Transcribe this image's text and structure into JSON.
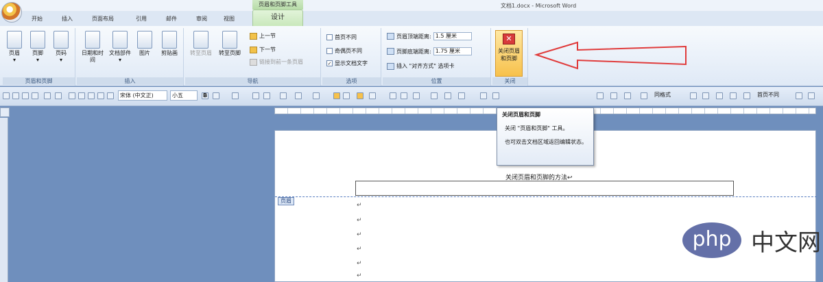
{
  "window": {
    "title": "文档1.docx - Microsoft Word",
    "context_group": "页眉和页脚工具"
  },
  "tabs": [
    "开始",
    "插入",
    "页面布局",
    "引用",
    "邮件",
    "审阅",
    "视图"
  ],
  "active_tab": "设计",
  "ribbon": {
    "group_header_footer": {
      "label": "页眉和页脚",
      "buttons": [
        "页眉",
        "页脚",
        "页码"
      ]
    },
    "group_insert": {
      "label": "插入",
      "buttons": [
        "日期和时间",
        "文档部件",
        "图片",
        "剪贴画"
      ]
    },
    "group_nav": {
      "label": "导航",
      "goto_header": "转至页眉",
      "goto_footer": "转至页脚",
      "prev": "上一节",
      "next": "下一节",
      "link": "链接到前一条页眉"
    },
    "group_options": {
      "label": "选项",
      "first_page": "首页不同",
      "odd_even": "奇偶页不同",
      "show_text": "显示文档文字"
    },
    "group_position": {
      "label": "位置",
      "header_top": "页眉顶端距离:",
      "header_top_value": "1.5 厘米",
      "footer_bottom": "页脚底端距离:",
      "footer_bottom_value": "1.75 厘米",
      "insert_align": "插入 \"对齐方式\" 选项卡"
    },
    "group_close": {
      "label": "关闭",
      "close_button": "关闭页眉和页脚"
    }
  },
  "toolbar": {
    "font_name": "宋体 (中文正)",
    "font_size": "小五",
    "right_text1": "同格式",
    "right_text2": "首页不同"
  },
  "tooltip": {
    "title": "关闭页眉和页脚",
    "line1": "关闭 \"页眉和页脚\" 工具。",
    "line2": "也可双击文档区域返回编辑状态。"
  },
  "document": {
    "header_text": "关闭页眉和页脚的方法↩",
    "header_tag": "页眉",
    "para_mark": "↵"
  },
  "watermark": {
    "logo": "php",
    "text": "中文网"
  },
  "colors": {
    "annotation_arrow": "#e03a3a",
    "close_highlight": "#f7c14b"
  }
}
